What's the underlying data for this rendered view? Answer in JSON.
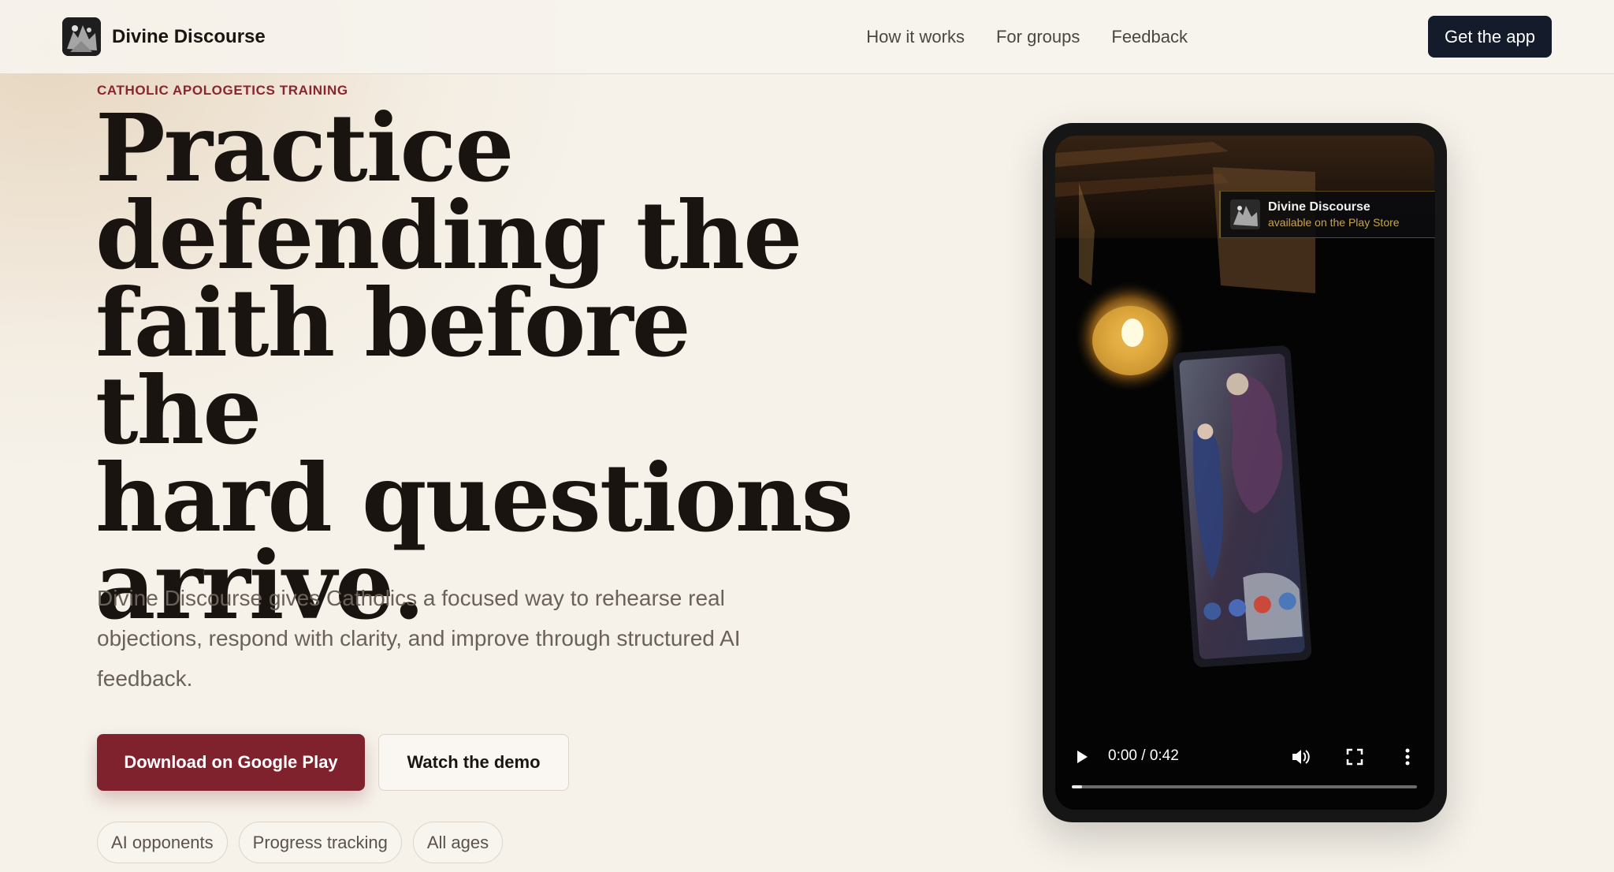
{
  "nav": {
    "brand": "Divine Discourse",
    "links": [
      "How it works",
      "For groups",
      "Feedback"
    ],
    "cta": "Get the app"
  },
  "hero": {
    "eyebrow": "CATHOLIC APOLOGETICS TRAINING",
    "headline_lines": [
      "Practice",
      "defending the",
      "faith before the",
      "hard questions",
      "arrive."
    ],
    "lead": "Divine Discourse gives Catholics a focused way to rehearse real objections, respond with clarity, and improve through structured AI feedback.",
    "primary_button": "Download on Google Play",
    "secondary_button": "Watch the demo",
    "chips": [
      "AI opponents",
      "Progress tracking",
      "All ages"
    ]
  },
  "video": {
    "badge_title": "Divine Discourse",
    "badge_subtitle": "available on the Play Store",
    "time": "0:00 / 0:42",
    "progress": 0.03,
    "icons": [
      "play-icon",
      "volume-icon",
      "fullscreen-icon",
      "more-vertical-icon"
    ]
  },
  "colors": {
    "accent": "#7f222d",
    "nav_cta": "#141b2b",
    "background": "#f6f2ea",
    "eyebrow": "#8a2530"
  }
}
